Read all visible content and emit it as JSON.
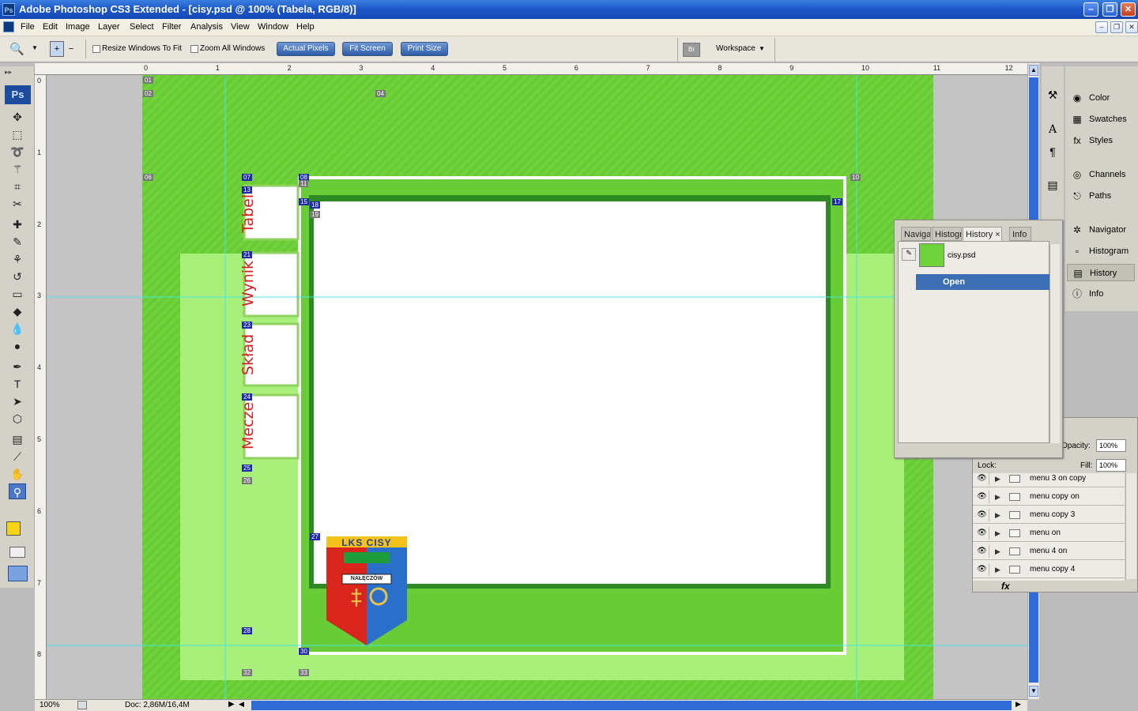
{
  "window": {
    "title": "Adobe Photoshop CS3 Extended - [cisy.psd @ 100% (Tabela, RGB/8)]",
    "app_badge": "Ps",
    "minimize": "‒",
    "restore": "❐",
    "close": "✕"
  },
  "menu": [
    "File",
    "Edit",
    "Image",
    "Layer",
    "Select",
    "Filter",
    "Analysis",
    "View",
    "Window",
    "Help"
  ],
  "options": {
    "resize_windows": "Resize Windows To Fit",
    "zoom_all": "Zoom All Windows",
    "actual_pixels": "Actual Pixels",
    "fit_screen": "Fit Screen",
    "print_size": "Print Size",
    "workspace": "Workspace"
  },
  "toolbox": {
    "badge": "Ps",
    "tools": [
      "move",
      "marquee",
      "lasso",
      "magic-wand",
      "crop",
      "slice",
      "healing",
      "brush",
      "clone-stamp",
      "history-brush",
      "eraser",
      "paint-bucket",
      "blur",
      "dodge",
      "pen",
      "type",
      "path-select",
      "shape",
      "notes",
      "eyedropper",
      "hand",
      "zoom"
    ],
    "foreground_color": "#f7d416",
    "background_color": "#ffffff"
  },
  "rulers": {
    "h": [
      "0",
      "1",
      "2",
      "3",
      "4",
      "5",
      "6",
      "7",
      "8",
      "9",
      "10",
      "11",
      "12"
    ],
    "v": [
      "0",
      "1",
      "2",
      "3",
      "4",
      "5",
      "6",
      "7",
      "8"
    ]
  },
  "canvas": {
    "tabs": [
      "Tabel",
      "Wynik",
      "Skład",
      "Meczе"
    ],
    "logo_top": "LKS CISY",
    "logo_town": "NAŁĘCZÓW",
    "slices": [
      "01",
      "02",
      "04",
      "06",
      "07",
      "08",
      "10",
      "11",
      "13",
      "15",
      "17",
      "18",
      "19",
      "21",
      "23",
      "24",
      "25",
      "26",
      "27",
      "28",
      "30",
      "32",
      "33"
    ],
    "colors": {
      "dark_green": "#4aa322",
      "bright_green": "#6fd23a",
      "light_green": "#a8f07a",
      "tab_text": "#d42020"
    }
  },
  "status": {
    "zoom": "100%",
    "doc": "Doc: 2,86M/16,4M"
  },
  "dock": {
    "group1": [
      "Color",
      "Swatches",
      "Styles"
    ],
    "group2": [
      "Channels",
      "Paths"
    ],
    "group3": [
      "Navigator",
      "Histogram",
      "History",
      "Info"
    ],
    "selected": "History"
  },
  "history_panel": {
    "tabs": [
      "Naviga",
      "Histogr",
      "History",
      "Info"
    ],
    "tab_close": "×",
    "snapshot": "cisy.psd",
    "states": [
      "Open"
    ]
  },
  "layers_panel": {
    "opacity_label": "Opacity:",
    "opacity": "100%",
    "lock_label": "Lock:",
    "fill_label": "Fill:",
    "fill": "100%",
    "layers": [
      "menu 3 on copy",
      "menu copy on",
      "menu copy 3",
      "menu on",
      "menu 4 on",
      "menu copy 4"
    ],
    "fx_label": "fx"
  }
}
